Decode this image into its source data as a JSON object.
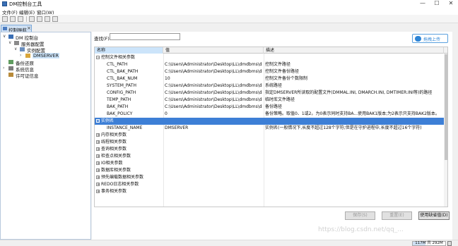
{
  "window": {
    "title": "DM控制台工具",
    "min": "—",
    "max": "☐",
    "close": "✕"
  },
  "menu": [
    "文件(F)",
    "编辑(E)",
    "窗口(W)"
  ],
  "nav": {
    "tab_label": "控制导航",
    "tree": [
      {
        "label": "DM 控制台",
        "arrow": "∨"
      },
      {
        "label": "服务器配置",
        "arrow": "∨"
      },
      {
        "label": "实例配置",
        "arrow": "∨"
      },
      {
        "label": "DMSERVER",
        "arrow": "›"
      },
      {
        "label": "备份还原",
        "arrow": ""
      },
      {
        "label": "系统信息",
        "arrow": "›"
      },
      {
        "label": "许可证信息",
        "arrow": ""
      }
    ]
  },
  "search": {
    "label": "查找(F):",
    "value": ""
  },
  "upload": {
    "label": "拖拽上传"
  },
  "table": {
    "headers": [
      "名称",
      "值",
      "描述"
    ],
    "rows": [
      {
        "type": "group",
        "expand": "−",
        "name": "控制文件相关参数"
      },
      {
        "type": "item",
        "name": "CTL_PATH",
        "value": "C:\\Users\\Administrator\\Desktop\\LL\\dmdbms\\data\\",
        "desc": "控制文件路径"
      },
      {
        "type": "item",
        "name": "CTL_BAK_PATH",
        "value": "C:\\Users\\Administrator\\Desktop\\LL\\dmdbms\\data\\",
        "desc": "控制文件备份路径"
      },
      {
        "type": "item",
        "name": "CTL_BAK_NUM",
        "value": "10",
        "desc": "控制文件备份个数限制"
      },
      {
        "type": "item",
        "name": "SYSTEM_PATH",
        "value": "C:\\Users\\Administrator\\Desktop\\LL\\dmdbms\\data\\",
        "desc": "系统路径"
      },
      {
        "type": "item",
        "name": "CONFIG_PATH",
        "value": "C:\\Users\\Administrator\\Desktop\\LL\\dmdbms\\data\\",
        "desc": "指定DMSERVER所读取的配置文件(DMMAL.INI, DMARCH.INI, DMTIMER.INI等)的路径"
      },
      {
        "type": "item",
        "name": "TEMP_PATH",
        "value": "C:\\Users\\Administrator\\Desktop\\LL\\dmdbms\\data\\",
        "desc": "临时库文件路径"
      },
      {
        "type": "item",
        "name": "BAK_PATH",
        "value": "C:\\Users\\Administrator\\Desktop\\LL\\dmdbms\\data\\",
        "desc": "备份路径"
      },
      {
        "type": "item",
        "name": "BAK_POLICY",
        "value": "0",
        "desc": "备份策略。取值0、1或2。为0表示同时支持BA...使用BAK1版本;为2表示只支持BAK2版本。"
      },
      {
        "type": "group-selected",
        "expand": "−",
        "name": "实例名"
      },
      {
        "type": "item",
        "name": "INSTANCE_NAME",
        "value": "DMSERVER",
        "desc": "实例名(一般情况下,长度不超过128个字符;但是在守护进程中,长度不超过16个字符)"
      },
      {
        "type": "group",
        "expand": "+",
        "name": "内存相关参数"
      },
      {
        "type": "group",
        "expand": "+",
        "name": "线程相关参数"
      },
      {
        "type": "group",
        "expand": "+",
        "name": "查询相关参数"
      },
      {
        "type": "group",
        "expand": "+",
        "name": "检查点相关参数"
      },
      {
        "type": "group",
        "expand": "+",
        "name": "IO相关参数"
      },
      {
        "type": "group",
        "expand": "+",
        "name": "数据库相关参数"
      },
      {
        "type": "group",
        "expand": "+",
        "name": "预先编载数据相关参数"
      },
      {
        "type": "group",
        "expand": "+",
        "name": "REDO日志相关参数"
      },
      {
        "type": "group",
        "expand": "+",
        "name": "事务相关参数"
      }
    ]
  },
  "buttons": {
    "save": "保存(S)",
    "reset": "重置(E)",
    "defaults": "使用缺省值(D)"
  },
  "status": {
    "memory": "117M 共 292M",
    "memory_used_fraction": 0.4
  },
  "watermark": "https://blog.csdn.net/qq_..."
}
